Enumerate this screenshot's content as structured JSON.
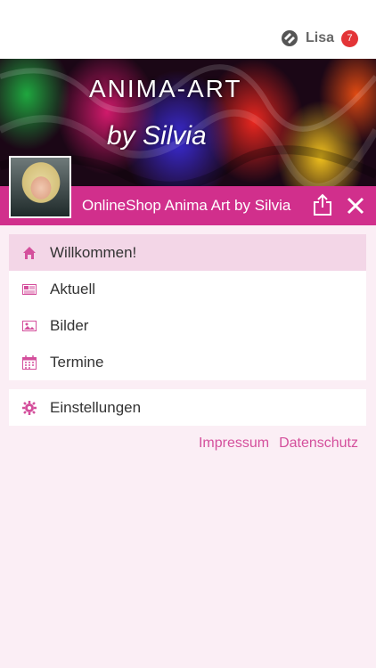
{
  "header": {
    "user_name": "Lisa",
    "notification_count": "7"
  },
  "banner": {
    "title_line1": "ANIMA-ART",
    "title_line2": "by Silvia"
  },
  "shop": {
    "title": "OnlineShop Anima Art by Silvia",
    "accent_color": "#d12f8c"
  },
  "menu": {
    "items": [
      {
        "label": "Willkommen!",
        "icon": "home-icon"
      },
      {
        "label": "Aktuell",
        "icon": "news-icon"
      },
      {
        "label": "Bilder",
        "icon": "image-icon"
      },
      {
        "label": "Termine",
        "icon": "calendar-icon"
      }
    ],
    "settings": {
      "label": "Einstellungen",
      "icon": "gear-icon"
    }
  },
  "footer": {
    "impressum": "Impressum",
    "datenschutz": "Datenschutz"
  }
}
